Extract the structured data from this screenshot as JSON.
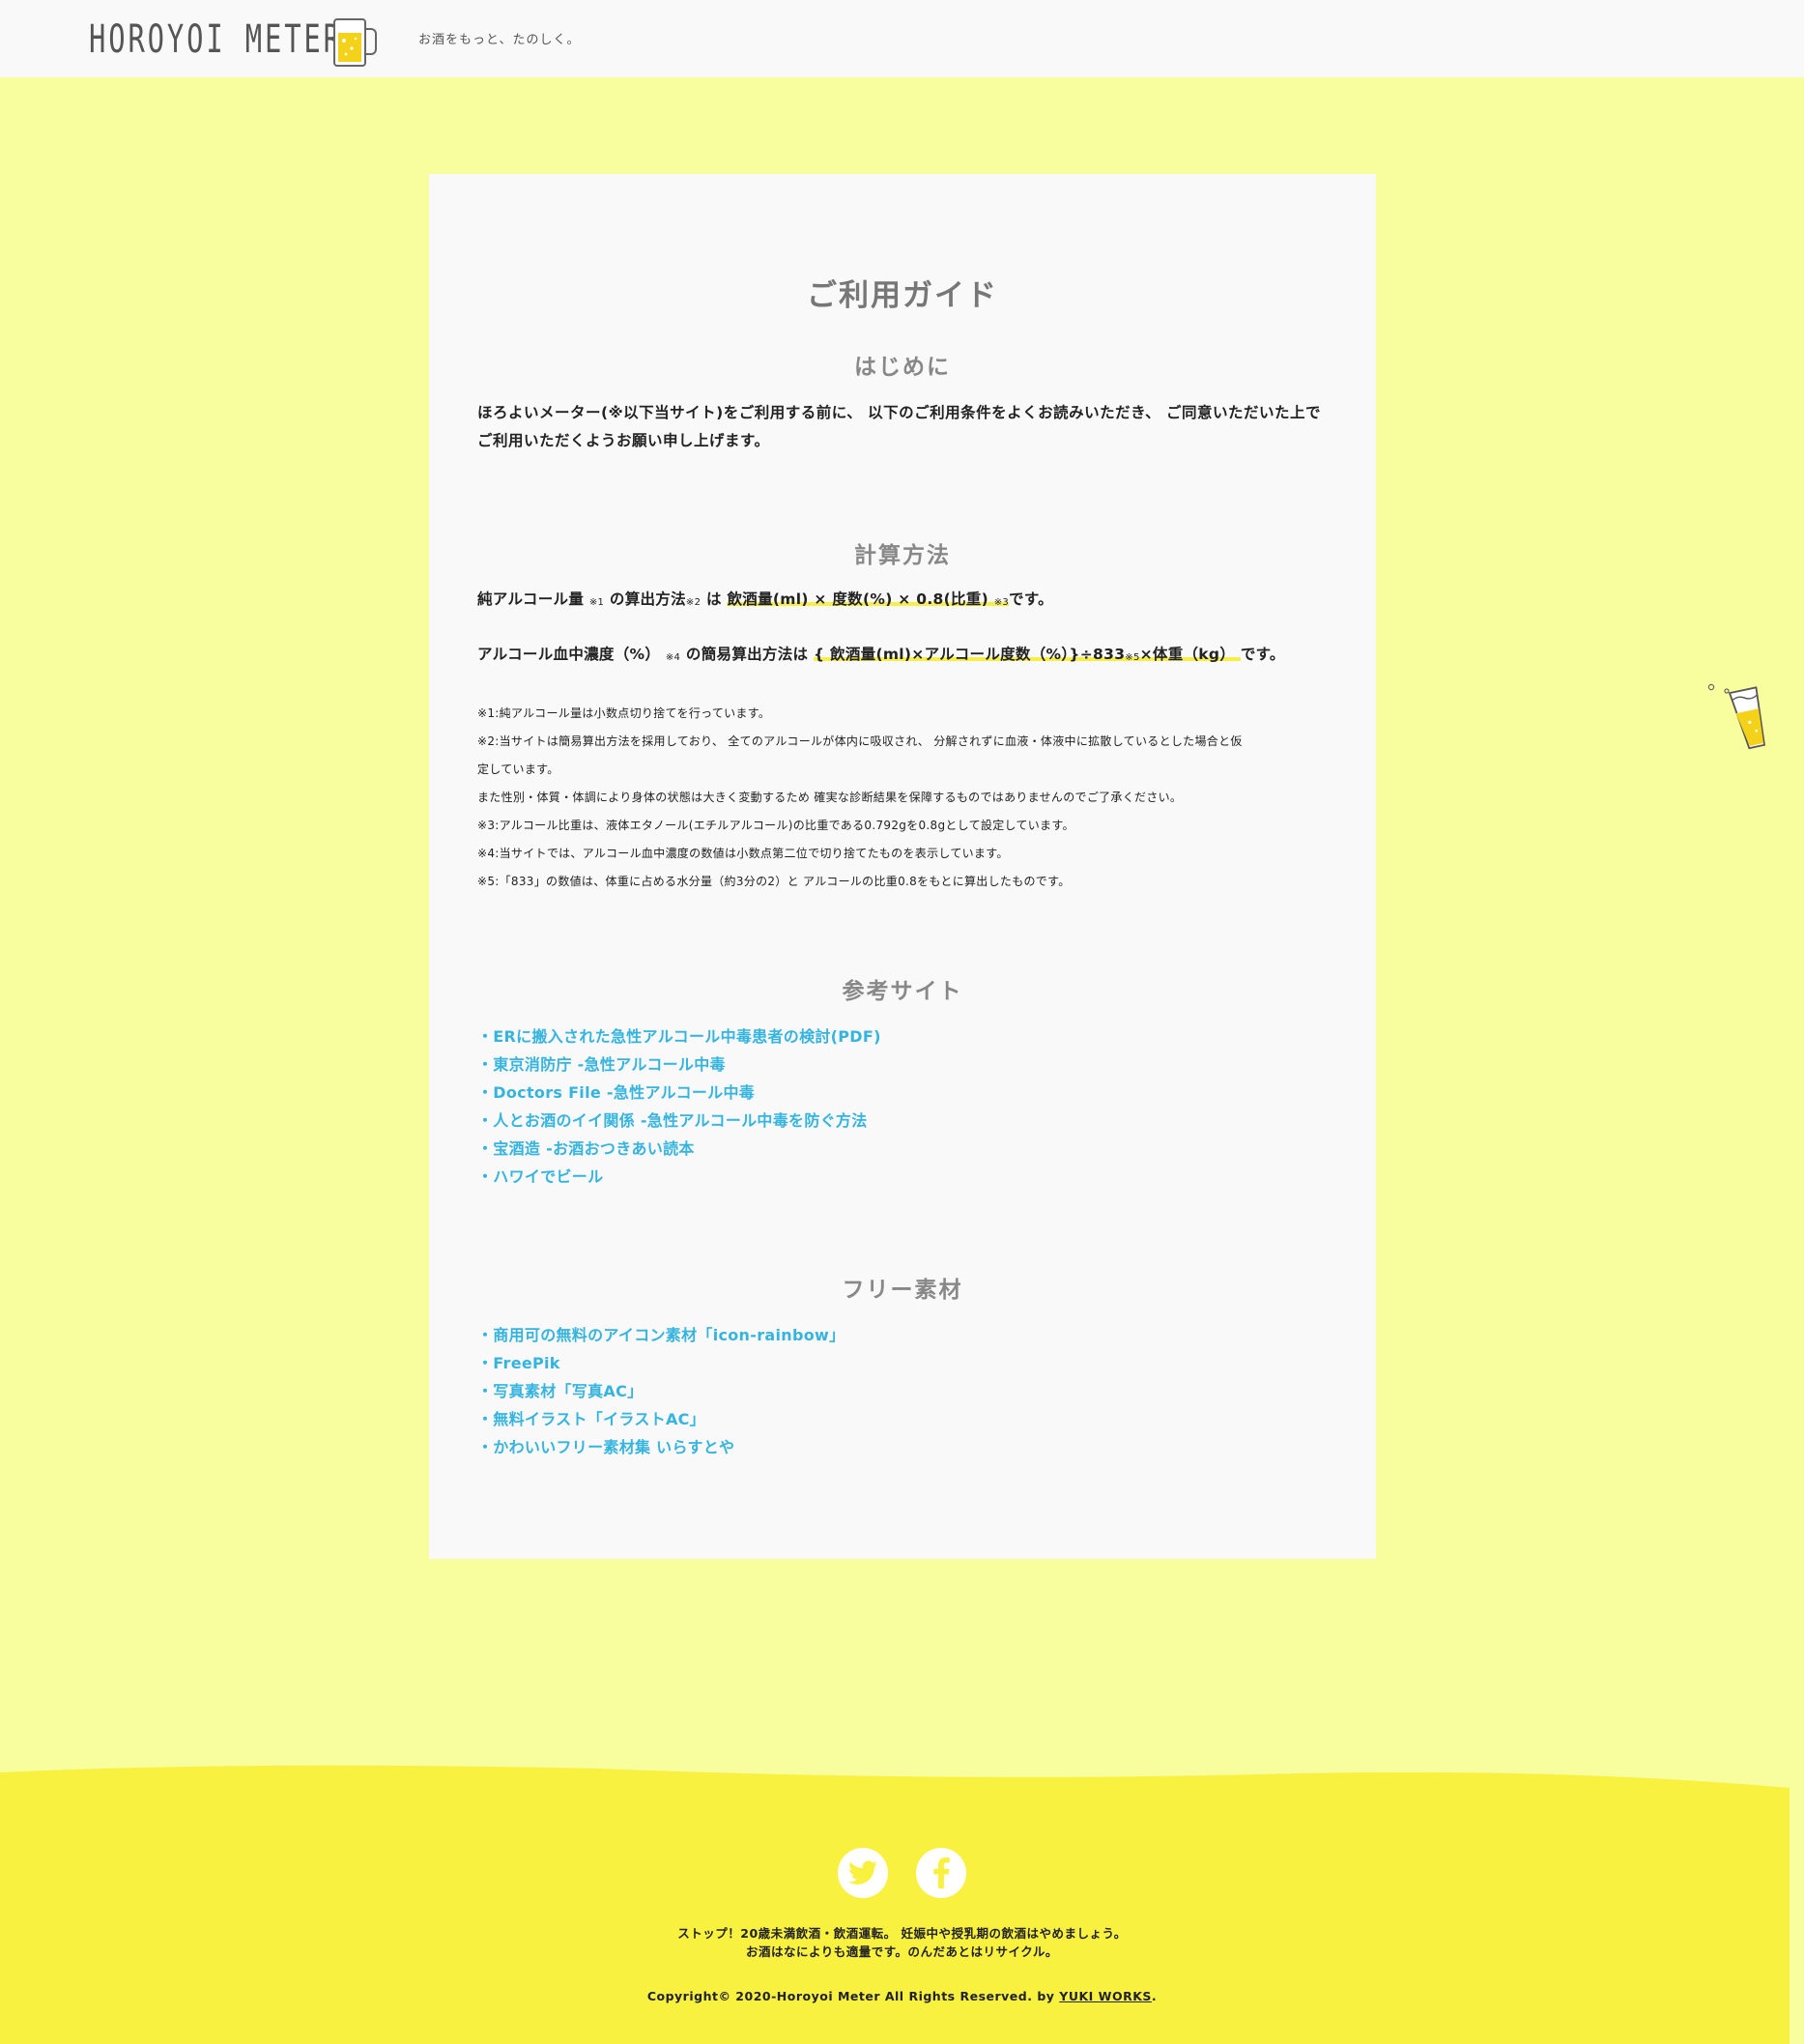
{
  "header": {
    "logo_text": "HOROYOI METER",
    "tagline": "お酒をもっと、たのしく。"
  },
  "guide": {
    "title": "ご利用ガイド",
    "intro": {
      "heading": "はじめに",
      "body": "ほろよいメーター(※以下当サイト)をご利用する前に、 以下のご利用条件をよくお読みいただき、 ご同意いただいた上でご利用いただくようお願い申し上げます。"
    },
    "calc": {
      "heading": "計算方法",
      "f1_lead": "純アルコール量",
      "f1_n1": "※1",
      "f1_mid": "の算出方法",
      "f1_n2": "※2",
      "f1_ha": "は",
      "f1_hl": "飲酒量(ml) × 度数(%) × 0.8(比重)",
      "f1_n3": "※3",
      "f1_end": "です。",
      "f2_lead": "アルコール血中濃度（%）",
      "f2_n4": "※4",
      "f2_mid": "の簡易算出方法は",
      "f2_hl_a": "{ 飲酒量(ml)×アルコール度数（%）}÷833",
      "f2_n5": "※5",
      "f2_hl_b": "×体重（kg）",
      "f2_end": "です。",
      "notes": [
        "※1:純アルコール量は小数点切り捨てを行っています。",
        "※2:当サイトは簡易算出方法を採用しており、 全てのアルコールが体内に吸収され、 分解されずに血液・体液中に拡散しているとした場合と仮",
        "定しています。",
        "また性別・体質・体調により身体の状態は大きく変動するため 確実な診断結果を保障するものではありませんのでご了承ください。",
        "※3:アルコール比重は、液体エタノール(エチルアルコール)の比重である0.792gを0.8gとして設定しています。",
        "※4:当サイトでは、アルコール血中濃度の数値は小数点第二位で切り捨てたものを表示しています。",
        "※5:「833」の数値は、体重に占める水分量（約3分の2）と アルコールの比重0.8をもとに算出したものです。"
      ]
    },
    "refs": {
      "heading": "参考サイト",
      "items": [
        "・ERに搬入された急性アルコール中毒患者の検討(PDF)",
        "・東京消防庁 -急性アルコール中毒",
        "・Doctors File -急性アルコール中毒",
        "・人とお酒のイイ関係 -急性アルコール中毒を防ぐ方法",
        "・宝酒造 -お酒おつきあい読本",
        "・ハワイでビール"
      ]
    },
    "free": {
      "heading": "フリー素材",
      "items": [
        "・商用可の無料のアイコン素材「icon-rainbow」",
        "・FreePik",
        "・写真素材「写真AC」",
        "・無料イラスト「イラストAC」",
        "・かわいいフリー素材集 いらすとや"
      ]
    }
  },
  "footer": {
    "social": [
      "twitter-icon",
      "facebook-icon"
    ],
    "warning_line1": "ストップ！20歳未満飲酒・飲酒運転。 妊娠中や授乳期の飲酒はやめましょう。",
    "warning_line2": "お酒はなによりも適量です。のんだあとはリサイクル。",
    "copyright": "Copyright© 2020-Horoyoi Meter All Rights Reserved. by",
    "copyright_link": "YUKI WORKS",
    "copyright_end": "."
  },
  "colors": {
    "background": "#f8fd9d",
    "footer": "#f9f140",
    "link": "#35b4e0",
    "highlight": "#f7ee4a",
    "card": "#f9f9f9"
  }
}
